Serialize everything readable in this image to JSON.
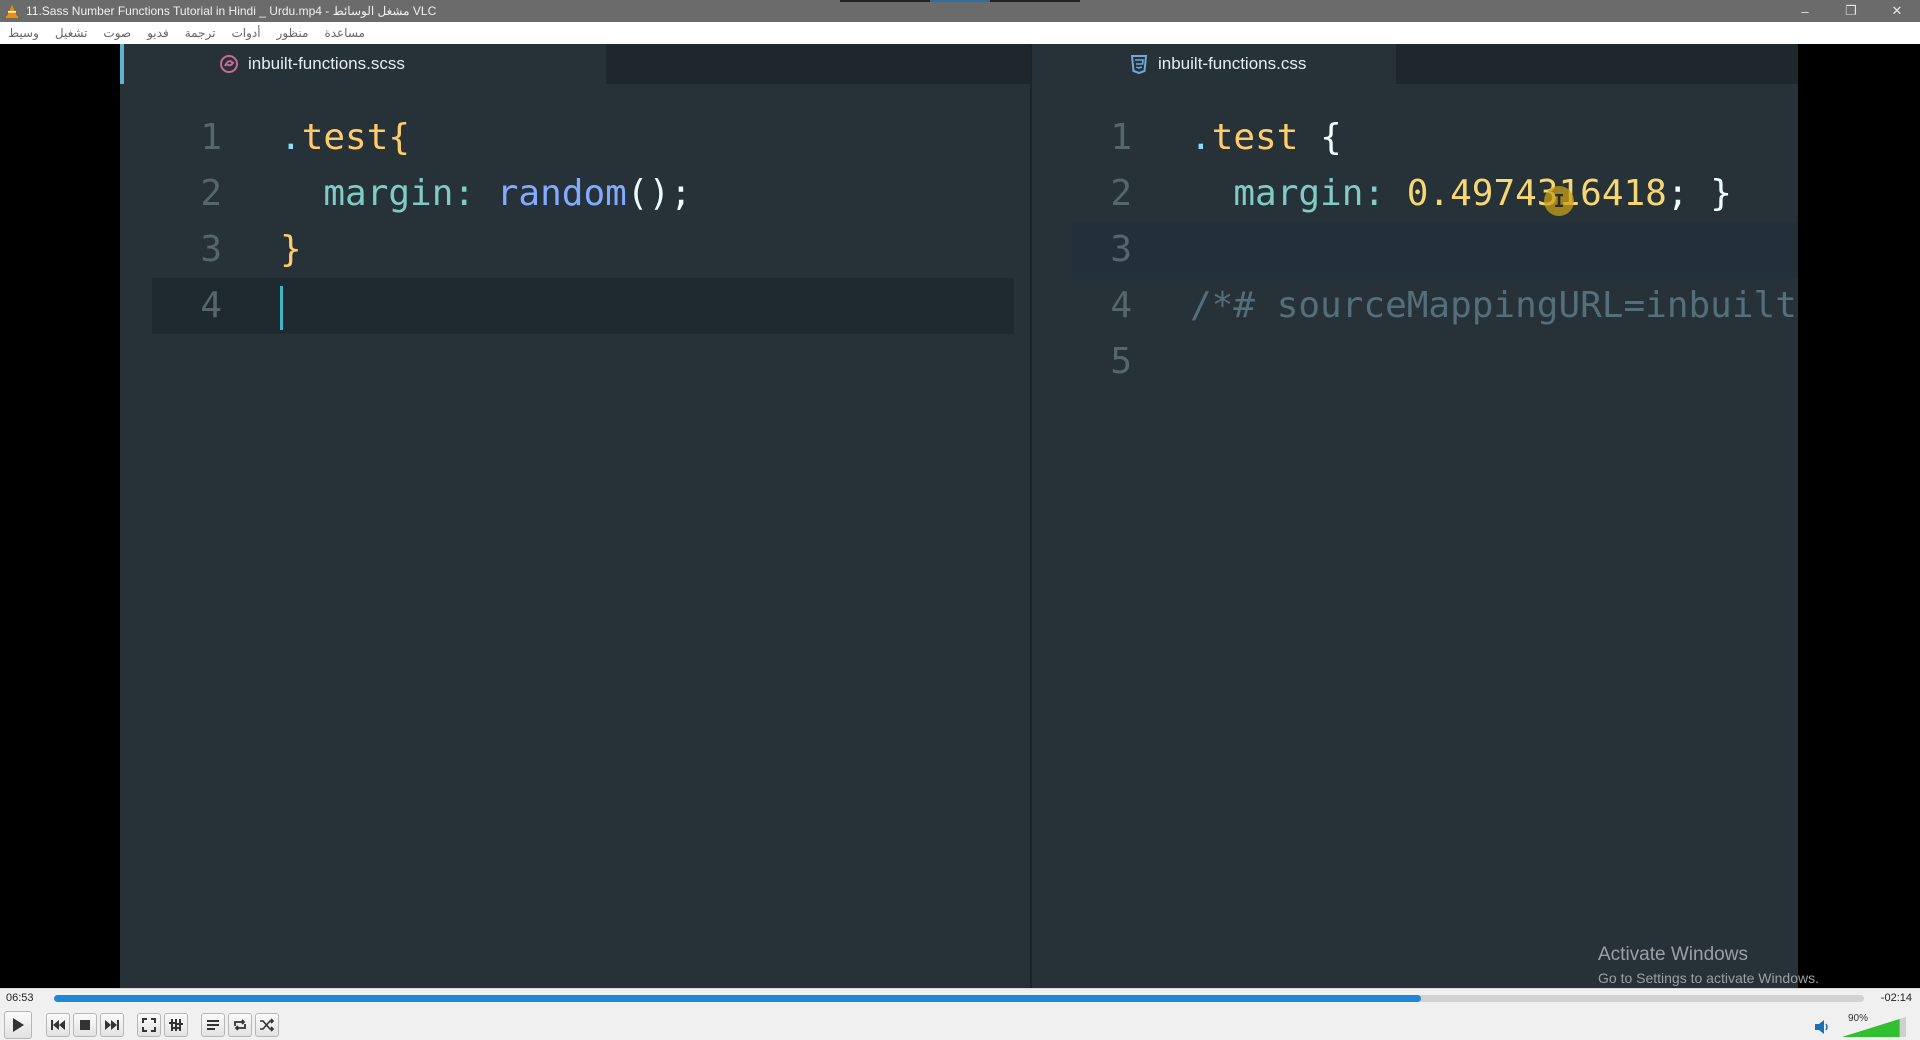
{
  "window": {
    "title": "11.Sass Number Functions Tutorial in Hindi _ Urdu.mp4 - مشغل الوسائط VLC",
    "app_icon": "vlc-cone-icon",
    "controls": [
      "minimize-icon",
      "restore-icon",
      "close-icon"
    ]
  },
  "menu": {
    "items": [
      "وسيط",
      "تشغيل",
      "صوت",
      "فديو",
      "ترجمة",
      "أدوات",
      "منظور",
      "مساعدة"
    ]
  },
  "editor": {
    "left_tab": {
      "filename": "inbuilt-functions.scss",
      "icon": "sass-icon",
      "lines": [
        {
          "num": "1",
          "tokens": [
            {
              "t": ".",
              "c": "tok-dot"
            },
            {
              "t": "test",
              "c": "tok-sel"
            },
            {
              "t": "{",
              "c": "tok-sel"
            }
          ]
        },
        {
          "num": "2",
          "tokens": [
            {
              "t": "  margin",
              "c": "tok-prop"
            },
            {
              "t": ": ",
              "c": "tok-prop"
            },
            {
              "t": "random",
              "c": "tok-func"
            },
            {
              "t": "();",
              "c": "tok-punc"
            }
          ]
        },
        {
          "num": "3",
          "tokens": [
            {
              "t": "}",
              "c": "tok-sel"
            }
          ]
        },
        {
          "num": "4",
          "tokens": []
        }
      ]
    },
    "right_tab": {
      "filename": "inbuilt-functions.css",
      "icon": "css3-icon",
      "lines": [
        {
          "num": "1",
          "tokens": [
            {
              "t": ".",
              "c": "tok-dot"
            },
            {
              "t": "test",
              "c": "tok-sel"
            },
            {
              "t": " {",
              "c": "tok-punc"
            }
          ]
        },
        {
          "num": "2",
          "tokens": [
            {
              "t": "  margin",
              "c": "tok-prop"
            },
            {
              "t": ": ",
              "c": "tok-prop"
            },
            {
              "t": "0.4974316418",
              "c": "tok-num"
            },
            {
              "t": "; }",
              "c": "tok-punc"
            }
          ]
        },
        {
          "num": "3",
          "tokens": []
        },
        {
          "num": "4",
          "tokens": [
            {
              "t": "/*# sourceMappingURL=inbuilt-",
              "c": "tok-comment"
            }
          ]
        },
        {
          "num": "5",
          "tokens": []
        }
      ]
    },
    "mouse_cursor_glyph": "I"
  },
  "watermark": {
    "title": "Activate Windows",
    "subtitle": "Go to Settings to activate Windows."
  },
  "player": {
    "elapsed": "06:53",
    "remaining": "-02:14",
    "progress": 0.755,
    "volume_label": "90%",
    "volume": 0.9,
    "buttons": [
      "play-icon",
      "previous-icon",
      "stop-icon",
      "next-icon",
      "fullscreen-icon",
      "extended-settings-icon",
      "playlist-icon",
      "loop-icon",
      "shuffle-icon"
    ],
    "accent": "#1e88d6"
  }
}
